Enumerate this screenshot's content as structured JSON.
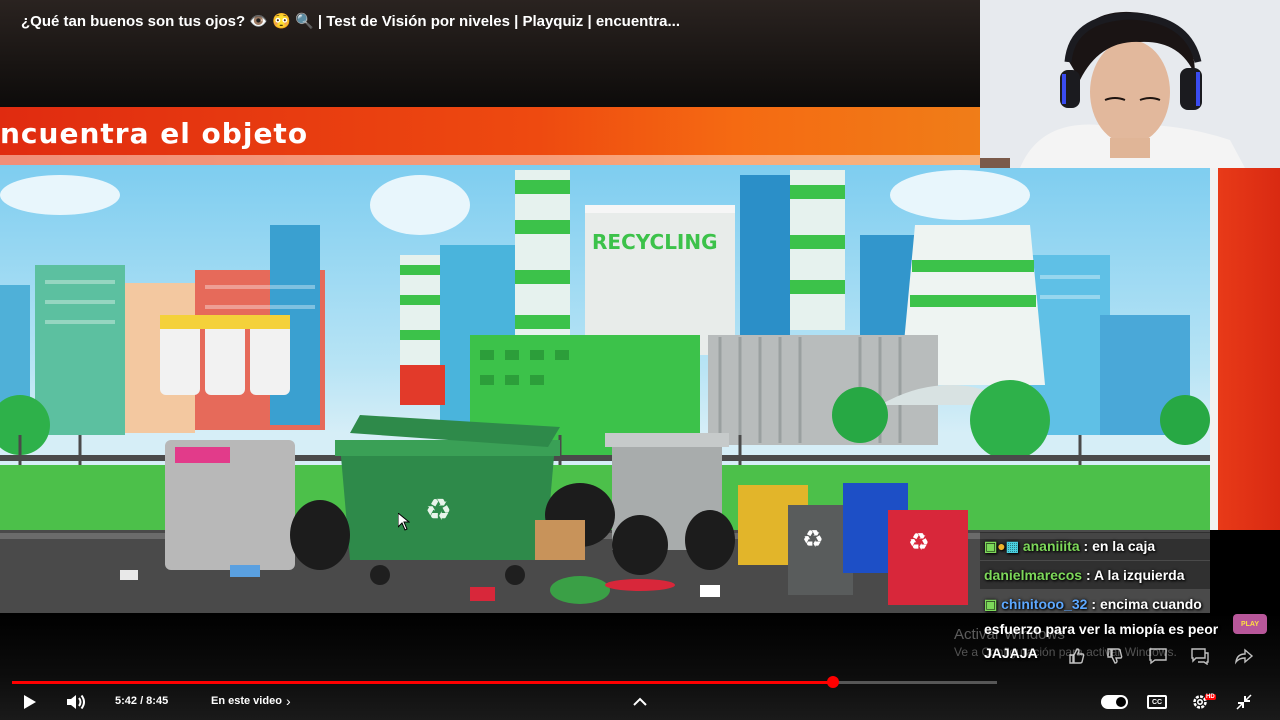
{
  "video": {
    "title": "¿Qué tan buenos son tus ojos? 👁️ 😳 🔍 | Test de Visión por niveles | Playquiz | encuentra...",
    "banner_text": "ncuentra el objeto",
    "scene_sign": "RECYCLING",
    "time_current": "5:42",
    "time_total": "8:45",
    "time_display": "5:42 / 8:45",
    "progress_fraction": 0.834,
    "chapters_label": "En este video"
  },
  "chat": {
    "messages": [
      {
        "user": "ananiiita",
        "sep": " : ",
        "text": "en la caja",
        "user_color": "#7dd85a"
      },
      {
        "user": "danielmarecos",
        "sep": " : ",
        "text": "A la izquierda",
        "user_color": "#7dd85a"
      },
      {
        "user": "chinitooo_32",
        "sep": " : ",
        "text": "encima cuando",
        "user_color": "#5da8ff"
      }
    ],
    "continuation_line1": "esfuerzo para ver la miopía es peor",
    "continuation_line2": "JAJAJA"
  },
  "watermark": {
    "line1": "Activar Windows",
    "line2": "Ve a Configuración para activar Windows."
  },
  "controls": {
    "play_icon": "play-icon",
    "volume_icon": "volume-icon",
    "autoplay": "on",
    "cc_label": "CC",
    "hd_badge": "HD"
  },
  "colors": {
    "progress": "#ff0000",
    "banner": "#ee4a10",
    "chat_user_green": "#7dd85a",
    "chat_user_blue": "#5da8ff"
  }
}
